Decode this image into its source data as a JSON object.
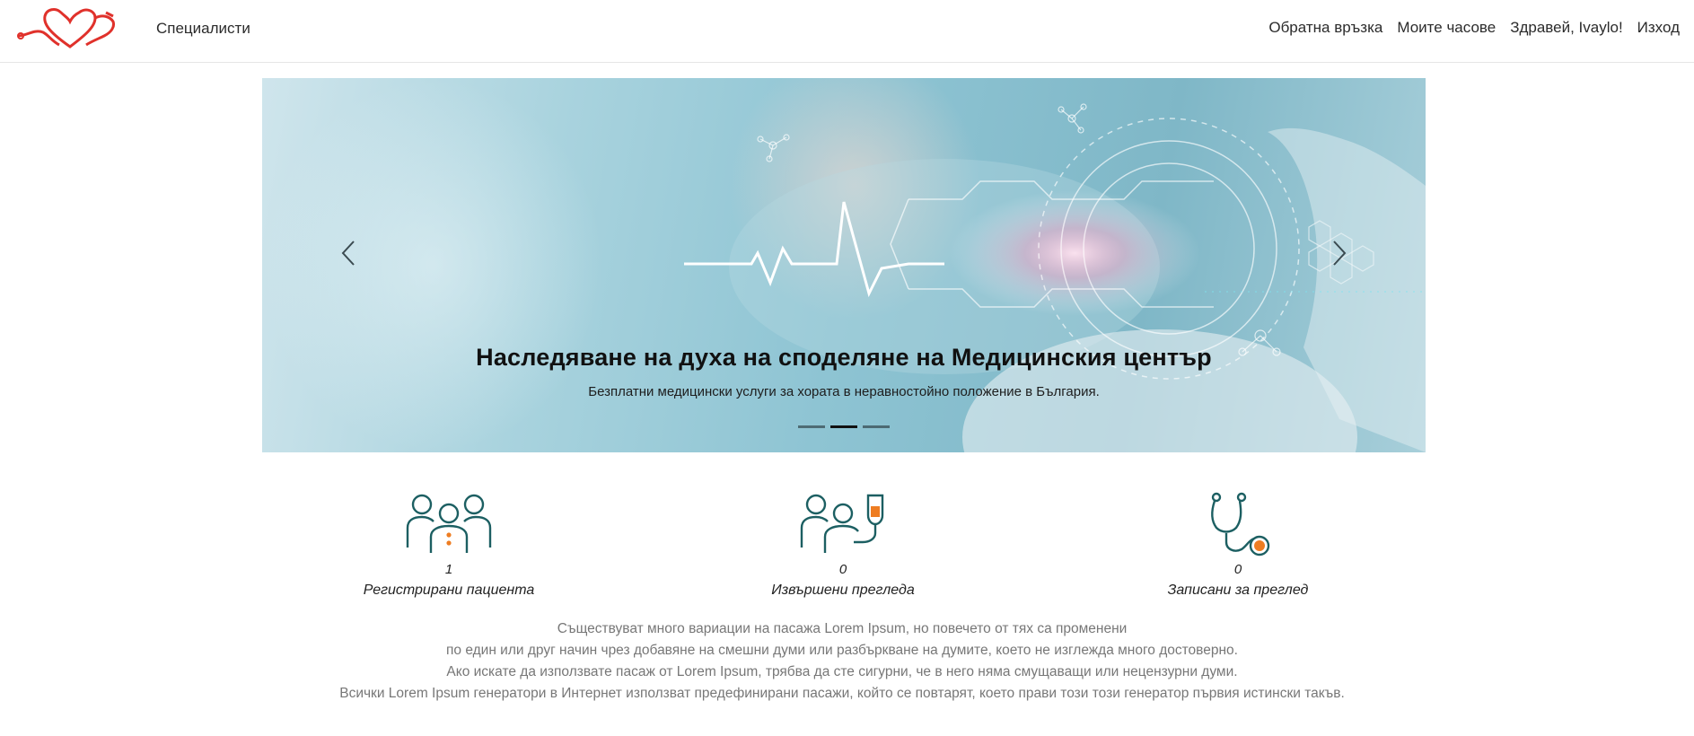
{
  "navbar": {
    "logo_icon": "heart-stethoscope-logo",
    "specialists_link": "Специалисти",
    "feedback_link": "Обратна връзка",
    "my_hours_link": "Моите часове",
    "greeting": "Здравей, Ivaylo!",
    "logout_link": "Изход"
  },
  "carousel": {
    "heading": "Наследяване на духа на споделяне на Медицинския център",
    "subheading": "Безплатни медицински услуги за хората в неравностойно положение в България.",
    "slides_count": 3,
    "active_slide": 2
  },
  "stats": [
    {
      "icon": "patients-icon",
      "value": "1",
      "label": "Регистрирани пациента"
    },
    {
      "icon": "examination-icon",
      "value": "0",
      "label": "Извършени прегледа"
    },
    {
      "icon": "stethoscope-icon",
      "value": "0",
      "label": "Записани за преглед"
    }
  ],
  "description": {
    "line1": "Съществуват много вариации на пасажа Lorem Ipsum, но повечето от тях са променени",
    "line2": "по един или друг начин чрез добавяне на смешни думи или разбъркване на думите, което не изглежда много достоверно.",
    "line3": "Ако искате да използвате пасаж от Lorem Ipsum, трябва да сте сигурни, че в него няма смущаващи или нецензурни думи.",
    "line4": "Всички Lorem Ipsum генератори в Интернет използват предефинирани пасажи, който се повтарят, което прави този този генератор първия истински такъв."
  },
  "colors": {
    "logo_red": "#e0312b",
    "icon_teal": "#1c5f62",
    "icon_orange": "#ee7d22",
    "text_gray": "#777777"
  }
}
